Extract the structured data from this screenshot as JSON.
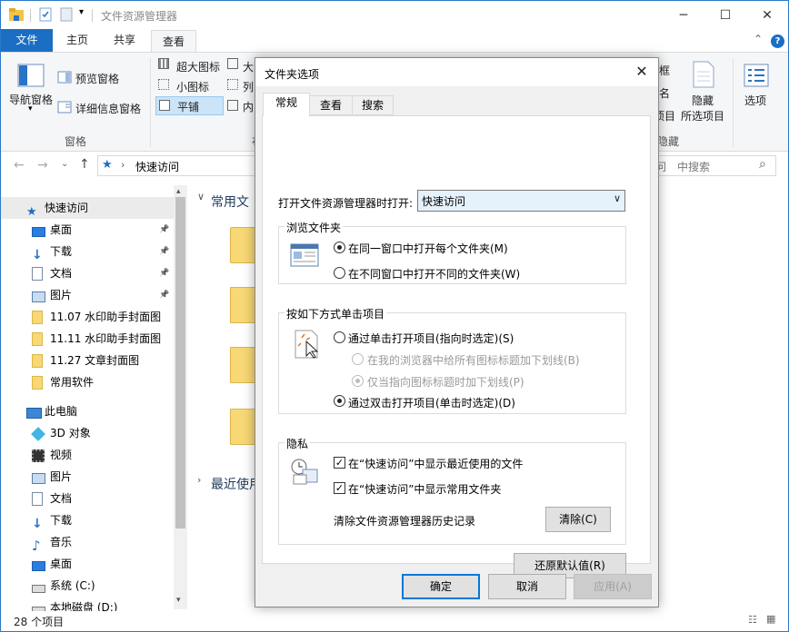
{
  "window": {
    "title": "文件资源管理器",
    "controls": {
      "minimize": "─",
      "maximize": "☐",
      "close": "✕"
    }
  },
  "ribbon_tabs": [
    "文件",
    "主页",
    "共享",
    "查看"
  ],
  "ribbon": {
    "nav_pane": "导航窗格",
    "preview_pane": "预览窗格",
    "details_pane": "详细信息窗格",
    "panes_group": "窗格",
    "layout": [
      "超大图标",
      "大",
      "小图标",
      "列",
      "平铺",
      "内"
    ],
    "right_fragments": [
      "框",
      "名",
      "项目",
      "/隐藏"
    ],
    "hide_selected": "隐藏",
    "selected_items": "所选项目",
    "options": "选项"
  },
  "address": {
    "path": "快速访问",
    "search_placeholder": "中搜索",
    "search_prefix": "问"
  },
  "nav_items": [
    {
      "label": "快速访问",
      "icon": "star-icon",
      "pinned": false
    },
    {
      "label": "桌面",
      "icon": "desktop-icon",
      "pinned": true
    },
    {
      "label": "下载",
      "icon": "download-icon",
      "pinned": true
    },
    {
      "label": "文档",
      "icon": "document-icon",
      "pinned": true
    },
    {
      "label": "图片",
      "icon": "picture-icon",
      "pinned": true
    },
    {
      "label": "11.07 水印助手封面图",
      "icon": "folder-icon",
      "pinned": false
    },
    {
      "label": "11.11 水印助手封面图",
      "icon": "folder-icon",
      "pinned": false
    },
    {
      "label": "11.27 文章封面图",
      "icon": "folder-icon",
      "pinned": false
    },
    {
      "label": "常用软件",
      "icon": "folder-icon",
      "pinned": false
    },
    {
      "label": "此电脑",
      "icon": "computer-icon",
      "pinned": false
    },
    {
      "label": "3D 对象",
      "icon": "cube-icon",
      "pinned": false
    },
    {
      "label": "视频",
      "icon": "video-icon",
      "pinned": false
    },
    {
      "label": "图片",
      "icon": "picture-icon",
      "pinned": false
    },
    {
      "label": "文档",
      "icon": "document-icon",
      "pinned": false
    },
    {
      "label": "下载",
      "icon": "download-icon",
      "pinned": false
    },
    {
      "label": "音乐",
      "icon": "music-icon",
      "pinned": false
    },
    {
      "label": "桌面",
      "icon": "desktop-icon",
      "pinned": false
    },
    {
      "label": "系统 (C:)",
      "icon": "drive-icon",
      "pinned": false
    },
    {
      "label": "本地磁盘 (D:)",
      "icon": "drive-icon",
      "pinned": false
    }
  ],
  "content": {
    "group1": "常用文",
    "group2": "最近使用"
  },
  "status": "28 个项目",
  "dialog": {
    "title": "文件夹选项",
    "tabs": [
      "常规",
      "查看",
      "搜索"
    ],
    "open_label": "打开文件资源管理器时打开:",
    "open_value": "快速访问",
    "browse": {
      "title": "浏览文件夹",
      "opt1": "在同一窗口中打开每个文件夹(M)",
      "opt2": "在不同窗口中打开不同的文件夹(W)"
    },
    "click": {
      "title": "按如下方式单击项目",
      "opt1": "通过单击打开项目(指向时选定)(S)",
      "sub1": "在我的浏览器中给所有图标标题加下划线(B)",
      "sub2": "仅当指向图标标题时加下划线(P)",
      "opt2": "通过双击打开项目(单击时选定)(D)"
    },
    "privacy": {
      "title": "隐私",
      "chk1": "在“快速访问”中显示最近使用的文件",
      "chk2": "在“快速访问”中显示常用文件夹",
      "clear_label": "清除文件资源管理器历史记录",
      "clear_button": "清除(C)"
    },
    "restore_button": "还原默认值(R)",
    "ok": "确定",
    "cancel": "取消",
    "apply": "应用(A)"
  }
}
